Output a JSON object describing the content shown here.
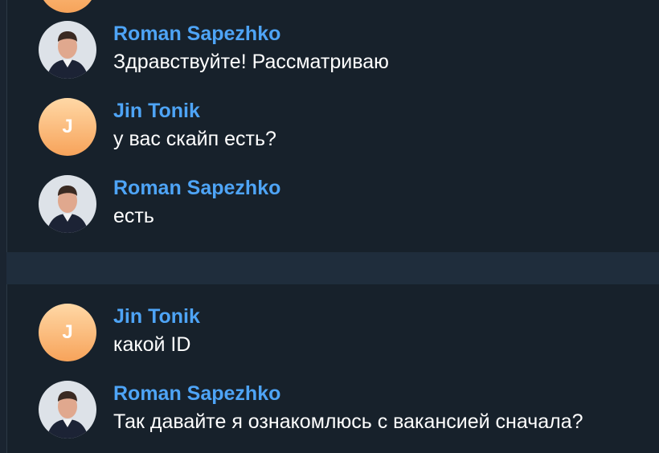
{
  "messages": [
    {
      "sender": "Roman Sapezhko",
      "text": "Здравствуйте! Рассматриваю",
      "avatar": "photo"
    },
    {
      "sender": "Jin Tonik",
      "text": "у вас скайп есть?",
      "avatar": "letter",
      "initial": "J"
    },
    {
      "sender": "Roman Sapezhko",
      "text": "есть",
      "avatar": "photo"
    },
    {
      "sender": "Jin Tonik",
      "text": "какой ID",
      "avatar": "letter",
      "initial": "J"
    },
    {
      "sender": "Roman Sapezhko",
      "text": "Так давайте я ознакомлюсь с вакансией сначала?",
      "avatar": "photo"
    }
  ],
  "colors": {
    "background": "#17212b",
    "sender_name": "#4ea4f6",
    "message_text": "#ffffff",
    "separator": "#1f2d3c"
  }
}
